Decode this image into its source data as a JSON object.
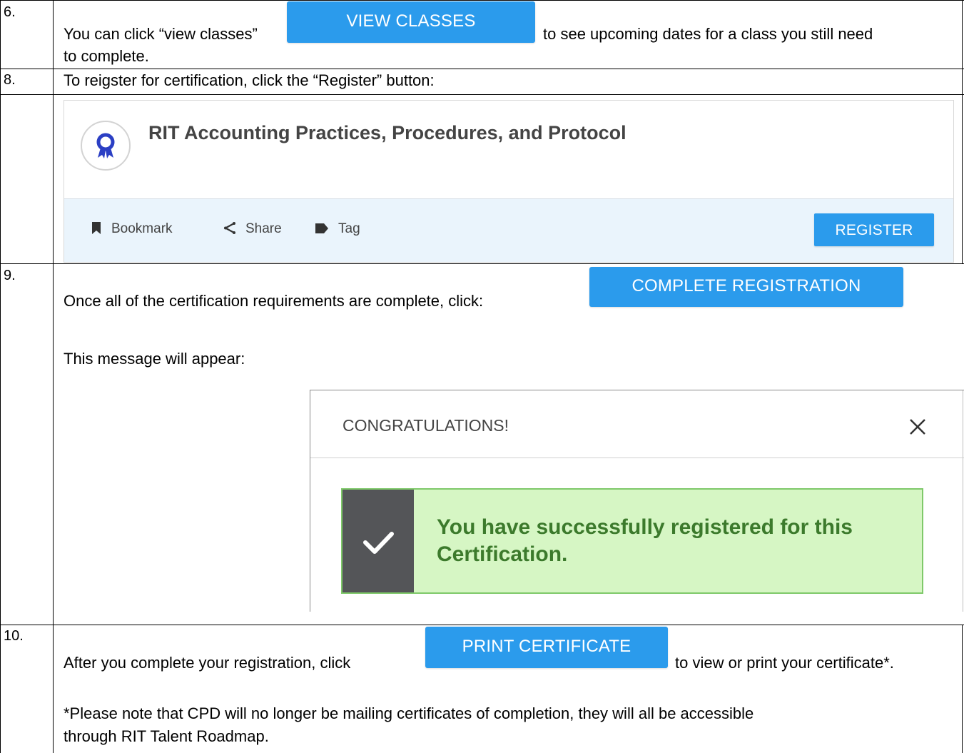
{
  "rows": {
    "r6": {
      "num": "6.",
      "text_before": "You can click “view classes”",
      "button": "VIEW CLASSES",
      "text_after": "to see upcoming dates for a class you still need",
      "text_line2": "to complete."
    },
    "r8": {
      "num": "8.",
      "text": "To reigster for certification, click the “Register” button:",
      "card": {
        "icon": "certification-ribbon-icon",
        "title": "RIT Accounting Practices, Procedures, and Protocol",
        "bookmark": "Bookmark",
        "share": "Share",
        "tag": "Tag",
        "register": "REGISTER"
      }
    },
    "r9": {
      "num": "9.",
      "text": "Once all of the certification requirements are complete, click:",
      "button": "COMPLETE REGISTRATION",
      "message_intro": "This message will appear:",
      "dialog": {
        "title": "CONGRATULATIONS!",
        "close_icon": "close-icon",
        "alert_line1": "You have successfully registered for this",
        "alert_line2": "Certification."
      }
    },
    "r10": {
      "num": "10.",
      "text_before": "After you complete your registration, click",
      "button": "PRINT CERTIFICATE",
      "text_after": "to view or print your certificate*.",
      "note_line1": "*Please note that CPD will no longer be mailing certificates of completion, they will all be accessible",
      "note_line2": "through RIT Talent Roadmap."
    }
  },
  "colors": {
    "button_blue": "#2b9bec",
    "footer_bg": "#eaf4fc",
    "alert_bg": "#d6f6c4",
    "alert_text": "#3c7a2c",
    "alert_icon_bg": "#545558"
  }
}
